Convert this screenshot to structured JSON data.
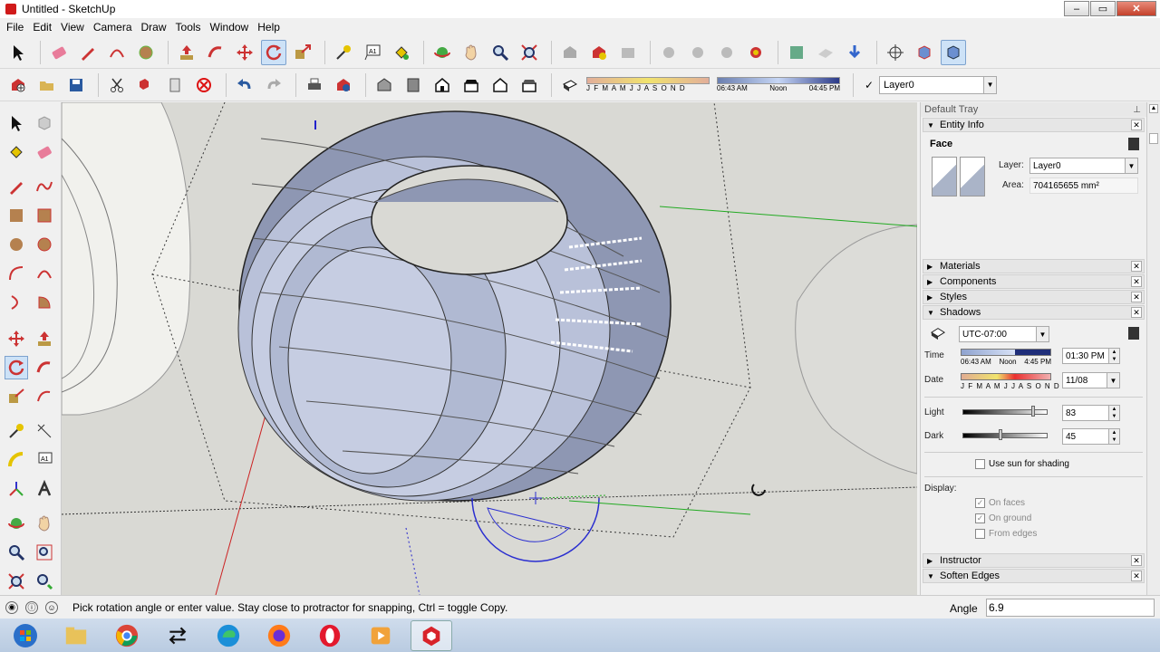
{
  "window": {
    "title": "Untitled - SketchUp",
    "minimize": "–",
    "maximize": "▭",
    "close": "✕"
  },
  "menu": [
    "File",
    "Edit",
    "View",
    "Camera",
    "Draw",
    "Tools",
    "Window",
    "Help"
  ],
  "toolbar2": {
    "months": "J F M A M J J A S O N D",
    "time_start": "06:43 AM",
    "time_noon": "Noon",
    "time_end": "04:45 PM",
    "layer_value": "Layer0"
  },
  "tray": {
    "title": "Default Tray",
    "entity_info": {
      "header": "Entity Info",
      "type": "Face",
      "layer_label": "Layer:",
      "layer_value": "Layer0",
      "area_label": "Area:",
      "area_value": "704165655 mm²"
    },
    "collapsed_panels": [
      "Materials",
      "Components",
      "Styles"
    ],
    "shadows": {
      "header": "Shadows",
      "timezone": "UTC-07:00",
      "time_label": "Time",
      "time_start": "06:43 AM",
      "time_noon": "Noon",
      "time_end": "4:45 PM",
      "time_value": "01:30 PM",
      "date_label": "Date",
      "date_months": "J F M A M J J A S O N D",
      "date_value": "11/08",
      "light_label": "Light",
      "light_value": "83",
      "light_level": 0.83,
      "dark_label": "Dark",
      "dark_value": "45",
      "dark_level": 0.45,
      "use_sun_label": "Use sun for shading",
      "display_label": "Display:",
      "on_faces": "On faces",
      "on_ground": "On ground",
      "from_edges": "From edges"
    },
    "instructor": "Instructor",
    "soften_edges": "Soften Edges"
  },
  "status": {
    "text": "Pick rotation angle or enter value.  Stay close to protractor for snapping, Ctrl = toggle Copy.",
    "vcb_label": "Angle",
    "vcb_value": "6.9"
  },
  "colors": {
    "face": "#b9c1d9",
    "face_dark": "#8e97b3",
    "protractor": "#2a2ed0",
    "axis_red": "#cc2222",
    "axis_green": "#22aa22",
    "axis_blue": "#2222cc"
  },
  "taskbar": [
    "start",
    "explorer",
    "chrome",
    "switch",
    "edge",
    "firefox",
    "opera",
    "media",
    "sketchup"
  ]
}
